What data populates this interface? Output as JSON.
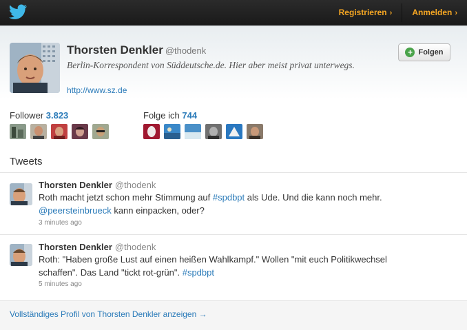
{
  "topnav": {
    "register": "Registrieren",
    "login": "Anmelden",
    "chevron": "›",
    "icon": "twitter-bird-icon",
    "accent": "#f5a623"
  },
  "profile": {
    "name": "Thorsten Denkler",
    "handle": "@thodenk",
    "bio": "Berlin-Korrespondent von Süddeutsche.de. Hier aber meist privat unterwegs.",
    "url": "http://www.sz.de",
    "follow_label": "Folgen"
  },
  "stats": {
    "followers_label": "Follower",
    "followers_count": "3.823",
    "following_label": "Folge ich",
    "following_count": "744"
  },
  "tweets_title": "Tweets",
  "tweets": [
    {
      "name": "Thorsten Denkler",
      "handle": "@thodenk",
      "text_pre": "Roth macht jetzt schon mehr Stimmung auf ",
      "hashtag": "#spdbpt",
      "text_mid": " als Ude. Und die kann noch mehr. ",
      "mention": "@peersteinbrueck",
      "text_post": " kann einpacken, oder?",
      "time": "3 minutes ago"
    },
    {
      "name": "Thorsten Denkler",
      "handle": "@thodenk",
      "text_pre": "Roth: \"Haben große Lust auf einen heißen Wahlkampf.\" Wollen \"mit euch Politikwechsel schaffen\". Das Land \"tickt rot-grün\". ",
      "hashtag": "#spdbpt",
      "time": "5 minutes ago"
    }
  ],
  "footer": {
    "full_profile": "Vollständiges Profil von Thorsten Denkler anzeigen →"
  },
  "colors": {
    "link": "#2b7bb9",
    "topbar": "#1f1f1f",
    "follow_plus": "#4aa34a"
  }
}
